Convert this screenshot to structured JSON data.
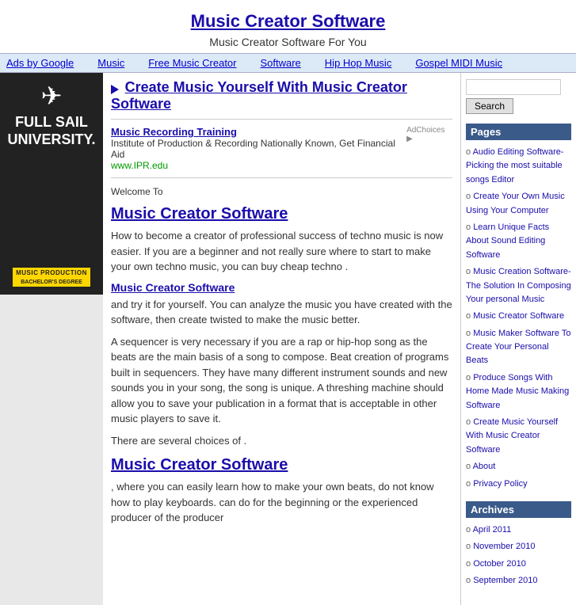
{
  "header": {
    "title": "Music Creator Software",
    "subtitle": "Music Creator Software For You",
    "title_link": "#"
  },
  "nav": {
    "items": [
      {
        "label": "Ads by Google",
        "href": "#"
      },
      {
        "label": "Music",
        "href": "#"
      },
      {
        "label": "Free Music Creator",
        "href": "#"
      },
      {
        "label": "Software",
        "href": "#"
      },
      {
        "label": "Hip Hop Music",
        "href": "#"
      },
      {
        "label": "Gospel MIDI Music",
        "href": "#"
      }
    ]
  },
  "left_ad": {
    "logo_top": "✈",
    "school_line1": "FULL SAIL",
    "school_line2": "UNIVERSITY.",
    "bottom_line1": "MUSIC PRODUCTION",
    "bottom_line2": "BACHELOR'S DEGREE"
  },
  "content": {
    "main_ad_title": "Create Music Yourself With Music Creator Software",
    "sub_ad_title": "Music Recording Training",
    "sub_ad_desc": "Institute of Production & Recording Nationally Known, Get Financial Aid",
    "sub_ad_url": "www.IPR.edu",
    "ad_choices": "AdChoices",
    "welcome": "Welcome To",
    "section1_title": "Music Creator Software",
    "section1_body1": "How to become a creator of professional success of techno music is now easier. If you are a beginner and not really sure where to start to make your own techno music, you can buy cheap techno .",
    "section1_link": "Music Creator Software",
    "section1_body2": "and try it for yourself. You can analyze the music you have created with the software, then create twisted to make the music better.",
    "section1_body3": "A sequencer is very necessary if you are a rap or hip-hop song as the beats are the main basis of a song to compose. Beat creation of programs built in sequencers. They have many different instrument sounds and new sounds you in your song, the song is unique. A threshing machine should allow you to save your publication in a format that is acceptable in other music players to save it.",
    "section1_body4": "There are several choices of .",
    "section2_title": "Music Creator Software",
    "section2_body1": ", where you can easily learn how to make your own beats, do not know how to play keyboards. can do for the beginning or the experienced producer of the producer"
  },
  "right_sidebar": {
    "search_placeholder": "",
    "search_button": "Search",
    "pages_title": "Pages",
    "pages_items": [
      {
        "label": "Audio Editing Software- Picking the most suitable songs Editor"
      },
      {
        "label": "Create Your Own Music Using Your Computer"
      },
      {
        "label": "Learn Unique Facts About Sound Editing Software"
      },
      {
        "label": "Music Creation Software- The Solution In Composing Your personal Music"
      },
      {
        "label": "Music Creator Software"
      },
      {
        "label": "Music Maker Software To Create Your Personal Beats"
      },
      {
        "label": "Produce Songs With Home Made Music Making Software"
      },
      {
        "label": "Create Music Yourself With Music Creator Software"
      },
      {
        "label": "About"
      },
      {
        "label": "Privacy Policy"
      }
    ],
    "archives_title": "Archives",
    "archives_items": [
      {
        "label": "April 2011"
      },
      {
        "label": "November 2010"
      },
      {
        "label": "October 2010"
      },
      {
        "label": "September 2010"
      }
    ]
  }
}
